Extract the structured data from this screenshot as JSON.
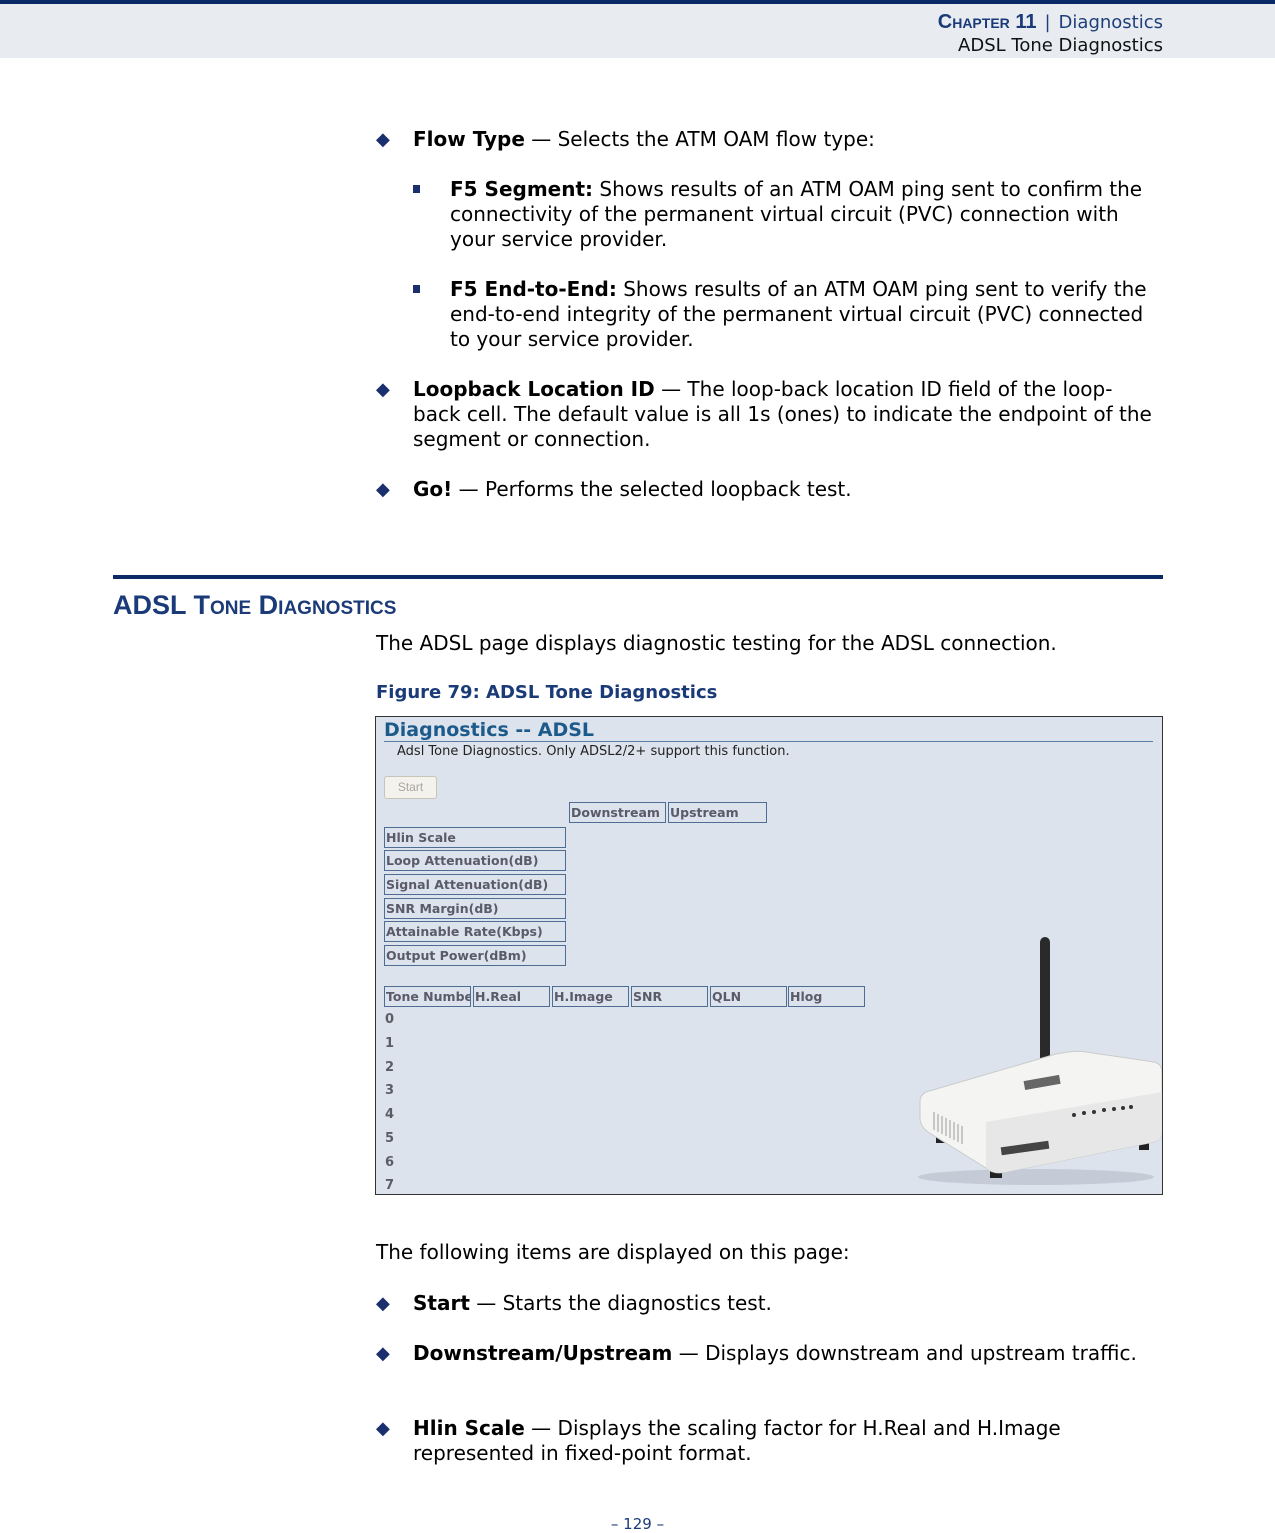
{
  "header": {
    "chapter": "Chapter 11",
    "separator": "|",
    "chapter_title": "Diagnostics",
    "section": "ADSL Tone Diagnostics"
  },
  "intro_bullets": [
    {
      "term": "Flow Type",
      "desc": " — Selects the ATM OAM flow type:"
    },
    {
      "term": "Loopback Location ID",
      "desc": " — The loop-back location ID field of the loop-back cell. The default value is all 1s (ones) to indicate the endpoint of the segment or connection."
    },
    {
      "term": "Go!",
      "desc": " — Performs the selected loopback test."
    }
  ],
  "flow_type_options": [
    {
      "term": "F5 Segment:",
      "desc": " Shows results of an ATM OAM ping sent to confirm the connectivity of the permanent virtual circuit (PVC) connection with your service provider."
    },
    {
      "term": "F5 End-to-End:",
      "desc": " Shows results of an ATM OAM ping sent to verify the end-to-end integrity of the permanent virtual circuit (PVC) connected to your service provider."
    }
  ],
  "section": {
    "title": "ADSL Tone Diagnostics",
    "intro": "The ADSL page displays diagnostic testing for the ADSL connection.",
    "figure_caption": "Figure 79:  ADSL Tone Diagnostics"
  },
  "figure": {
    "title": "Diagnostics -- ADSL",
    "description": "Adsl Tone Diagnostics. Only ADSL2/2+ support this function.",
    "start_button": "Start",
    "columns": [
      "Downstream",
      "Upstream"
    ],
    "rows": [
      "Hlin Scale",
      "Loop Attenuation(dB)",
      "Signal Attenuation(dB)",
      "SNR Margin(dB)",
      "Attainable Rate(Kbps)",
      "Output Power(dBm)"
    ],
    "tone_headers": [
      "Tone Number",
      "H.Real",
      "H.Image",
      "SNR",
      "QLN",
      "Hlog"
    ],
    "tone_numbers": [
      "0",
      "1",
      "2",
      "3",
      "4",
      "5",
      "6",
      "7"
    ],
    "router_image": "adsl-router-photo"
  },
  "after_text": "The following items are displayed on this page:",
  "item_bullets": [
    {
      "term": "Start",
      "desc": " — Starts the diagnostics test."
    },
    {
      "term": "Downstream/Upstream",
      "desc": " — Displays downstream and upstream traffic."
    },
    {
      "term": "Hlin Scale",
      "desc": " — Displays the scaling factor for H.Real and H.Image represented in fixed-point format."
    }
  ],
  "page_number": "–  129  –"
}
